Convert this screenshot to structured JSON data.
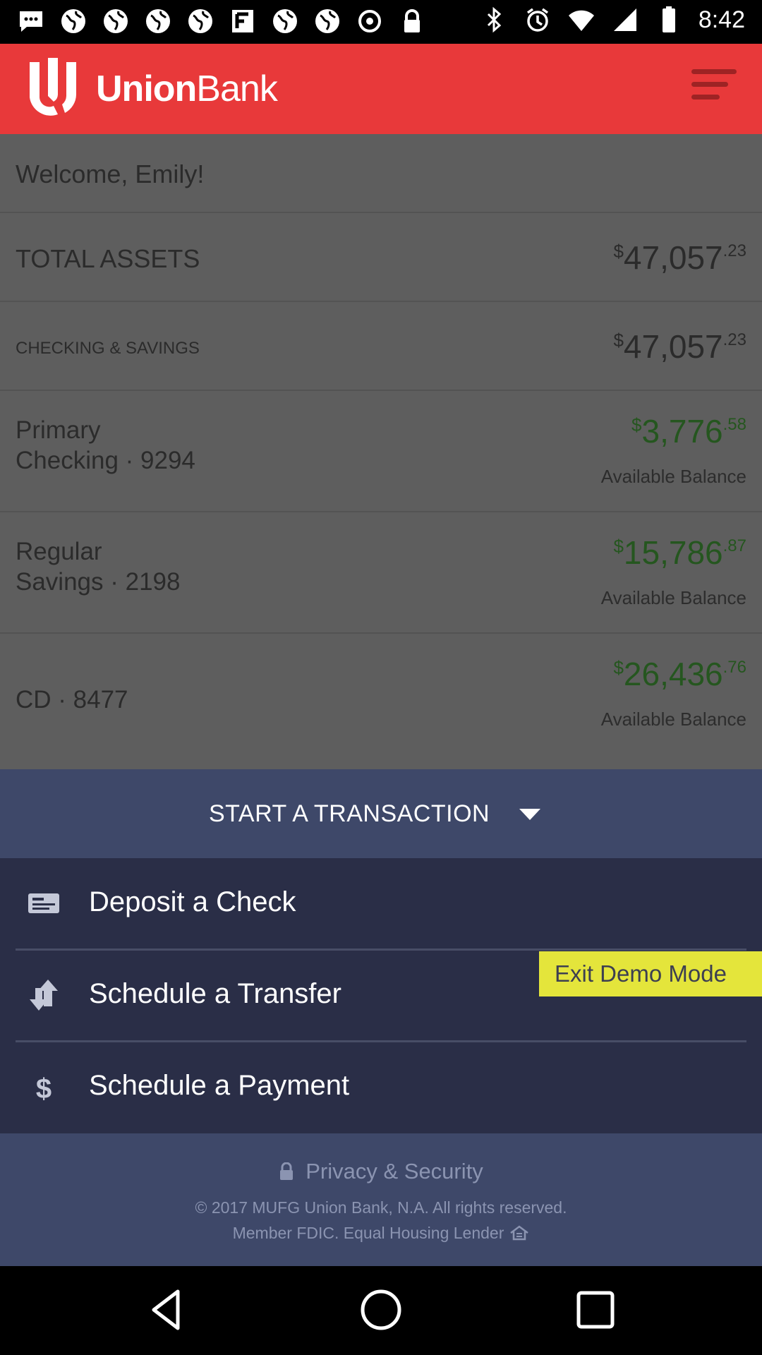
{
  "status_bar": {
    "time": "8:42",
    "left_icons": [
      "chat-bubble-icon",
      "globe-icon",
      "globe-icon",
      "globe-icon",
      "globe-icon",
      "flipboard-icon",
      "globe-icon",
      "globe-icon",
      "sync-icon",
      "lock-icon"
    ],
    "right_icons": [
      "bluetooth-icon",
      "alarm-icon",
      "wifi-icon",
      "signal-icon",
      "battery-icon"
    ]
  },
  "header": {
    "brand_bold": "Union",
    "brand_light": "Bank",
    "colors": {
      "background": "#e8393a",
      "menu": "#9e2324"
    }
  },
  "welcome": "Welcome, Emily!",
  "total_assets": {
    "label": "TOTAL ASSETS",
    "currency": "$",
    "whole": "47,057",
    "cents": ".23"
  },
  "checking_savings": {
    "label": "CHECKING & SAVINGS",
    "currency": "$",
    "whole": "47,057",
    "cents": ".23"
  },
  "accounts": [
    {
      "line1": "Primary",
      "line2": "Checking · 9294",
      "currency": "$",
      "whole": "3,776",
      "cents": ".58",
      "sub": "Available Balance"
    },
    {
      "line1": "Regular",
      "line2": "Savings · 2198",
      "currency": "$",
      "whole": "15,786",
      "cents": ".87",
      "sub": "Available Balance"
    },
    {
      "line1": "CD · 8477",
      "currency": "$",
      "whole": "26,436",
      "cents": ".76",
      "sub": "Available Balance"
    }
  ],
  "transaction": {
    "title": "START A TRANSACTION",
    "items": [
      {
        "label": "Deposit a Check",
        "icon": "check-icon"
      },
      {
        "label": "Schedule a Transfer",
        "icon": "transfer-arrows-icon"
      },
      {
        "label": "Schedule a Payment",
        "icon": "dollar-icon"
      }
    ]
  },
  "exit_demo": "Exit Demo Mode",
  "footer": {
    "privacy": "Privacy & Security",
    "copyright": "© 2017 MUFG Union Bank, N.A. All rights reserved.",
    "fdic": "Member FDIC. Equal Housing Lender"
  },
  "nav": [
    "back-icon",
    "home-icon",
    "recents-icon"
  ]
}
